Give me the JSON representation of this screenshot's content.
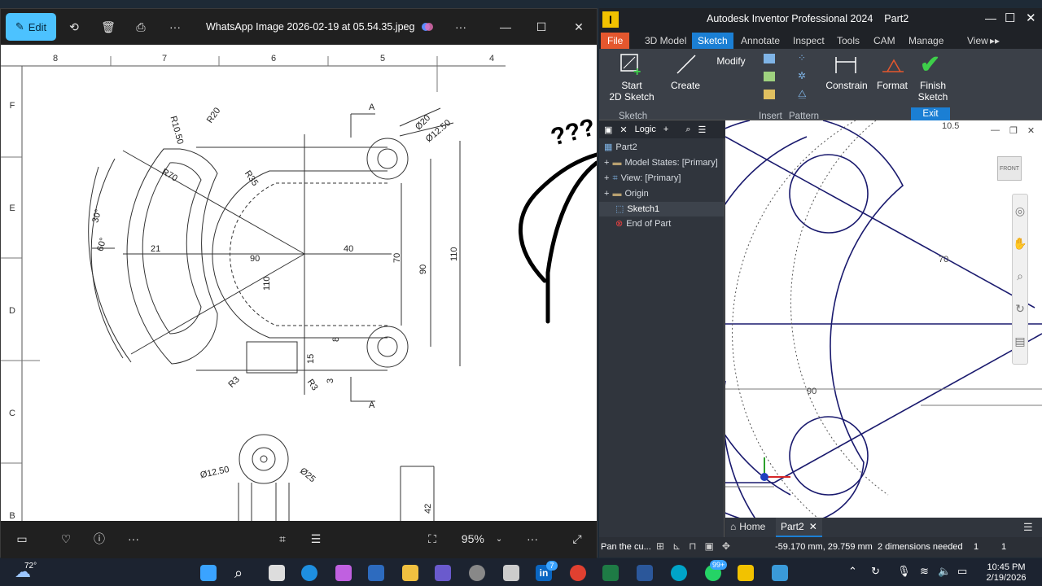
{
  "photos": {
    "edit_label": "Edit",
    "title": "WhatsApp Image 2026-02-19 at 05.54.35.jpeg",
    "zoom": "95%",
    "drawing": {
      "col_labels": [
        "8",
        "7",
        "6",
        "5",
        "4"
      ],
      "row_labels": [
        "F",
        "E",
        "D",
        "C",
        "B"
      ],
      "dims": [
        "R10.50",
        "R20",
        "R70",
        "R35",
        "30°",
        "60°",
        "21",
        "90",
        "40",
        "70",
        "90",
        "110",
        "110",
        "8",
        "15",
        "3",
        "R3",
        "R3",
        "A",
        "A",
        "Ø20",
        "Ø12.50",
        "Ø12.50",
        "Ø25",
        "42"
      ],
      "doodle": "???"
    }
  },
  "inventor": {
    "title": "Autodesk Inventor Professional 2024",
    "doc_name": "Part2",
    "tabs": [
      "File",
      "3D Model",
      "Sketch",
      "Annotate",
      "Inspect",
      "Tools",
      "CAM",
      "Manage",
      "View"
    ],
    "active_tab": "Sketch",
    "ribbon": {
      "start_sketch": "Start\n2D Sketch",
      "create": "Create",
      "modify": "Modify",
      "constrain": "Constrain",
      "format": "Format",
      "finish": "Finish\nSketch",
      "groups": [
        "Sketch",
        "Insert",
        "Pattern",
        "Exit"
      ]
    },
    "browser": {
      "mode": "Logic",
      "items": [
        "Part2",
        "Model States: [Primary]",
        "View: [Primary]",
        "Origin",
        "Sketch1",
        "End of Part"
      ]
    },
    "viewcube": "FRONT",
    "sketch_dims": [
      "10.5",
      "70",
      "90"
    ],
    "doc_tabs": [
      "Home",
      "Part2"
    ],
    "status": {
      "hint": "Pan the cu...",
      "coords": "-59.170 mm, 29.759 mm",
      "dims_needed": "2 dimensions needed",
      "n1": "1",
      "n2": "1"
    }
  },
  "taskbar": {
    "weather": "72°",
    "time": "10:45 PM",
    "date": "2/19/2026",
    "badge1": "7",
    "badge2": "99+"
  }
}
